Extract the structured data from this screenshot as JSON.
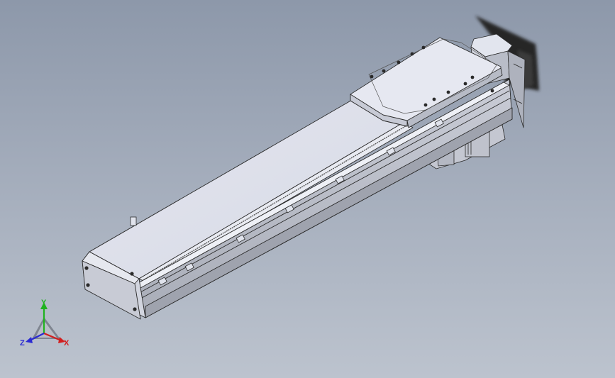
{
  "scene": {
    "background_top": "#8d98aa",
    "background_bottom": "#bcc3ce",
    "model": "linear-actuator-module",
    "part_color": "#dcdfe8",
    "edge_color": "#2a2a2a"
  },
  "triad": {
    "x_label": "X",
    "y_label": "Y",
    "z_label": "Z",
    "x_color": "#d21f1f",
    "y_color": "#1fb31f",
    "z_color": "#2a2ad2"
  }
}
